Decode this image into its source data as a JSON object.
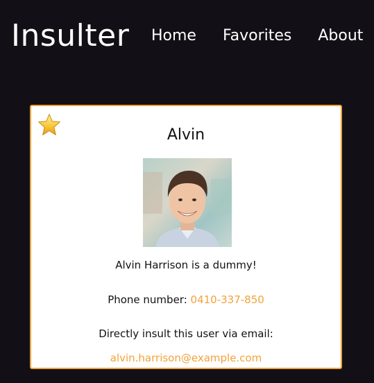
{
  "header": {
    "brand": "Insulter",
    "nav": [
      "Home",
      "Favorites",
      "About"
    ]
  },
  "card": {
    "name": "Alvin",
    "description": "Alvin Harrison is a dummy!",
    "phone_label": "Phone number: ",
    "phone": "0410-337-850",
    "email_prompt": "Directly insult this user via email:",
    "email": "alvin.harrison@example.com",
    "favorite_icon": "star-icon"
  },
  "colors": {
    "background": "#121016",
    "accent": "#f2a23a",
    "card_bg": "#ffffff"
  }
}
